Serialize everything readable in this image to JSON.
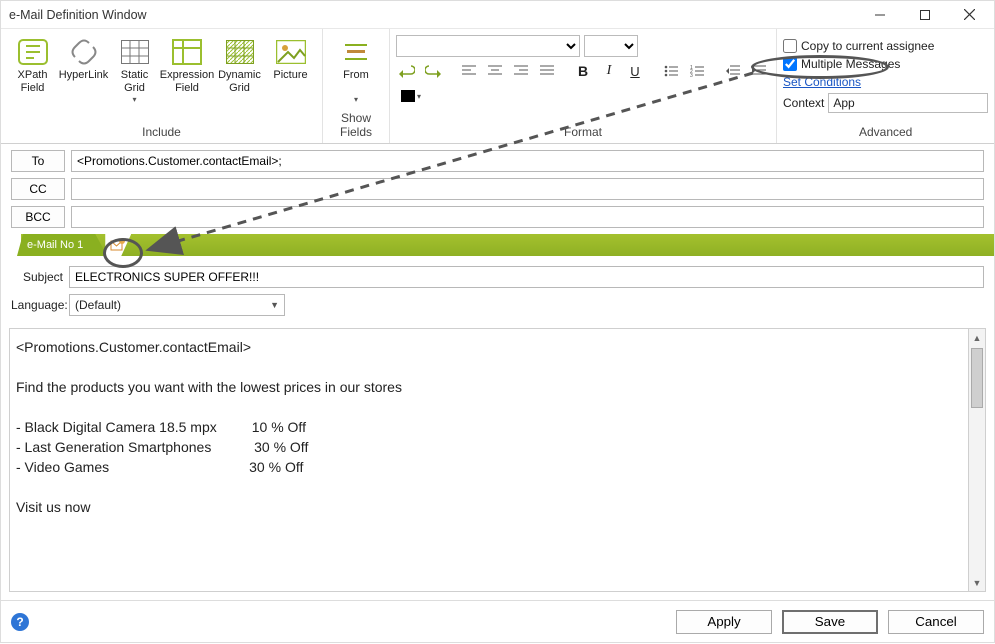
{
  "window": {
    "title": "e-Mail Definition Window"
  },
  "ribbon": {
    "include": {
      "label": "Include",
      "items": [
        {
          "label": "XPath\nField"
        },
        {
          "label": "HyperLink"
        },
        {
          "label": "Static\nGrid"
        },
        {
          "label": "Expression\nField"
        },
        {
          "label": "Dynamic\nGrid"
        },
        {
          "label": "Picture"
        }
      ]
    },
    "showfields": {
      "label": "Show Fields",
      "from": "From"
    },
    "format": {
      "label": "Format"
    },
    "advanced": {
      "label": "Advanced",
      "copy_assignee": "Copy to current assignee",
      "multiple_messages": "Multiple Messages",
      "set_conditions": "Set Conditions",
      "context_label": "Context",
      "context_value": "App"
    }
  },
  "fields": {
    "to_btn": "To",
    "cc_btn": "CC",
    "bcc_btn": "BCC",
    "to_value": "<Promotions.Customer.contactEmail>;",
    "cc_value": "",
    "bcc_value": ""
  },
  "tabs": {
    "email_tab": "e-Mail No 1"
  },
  "detail": {
    "subject_label": "Subject",
    "subject_value": "ELECTRONICS SUPER OFFER!!!",
    "language_label": "Language:",
    "language_value": "(Default)"
  },
  "body": "<Promotions.Customer.contactEmail>\n\nFind the products you want with the lowest prices in our stores\n\n- Black Digital Camera 18.5 mpx         10 % Off\n- Last Generation Smartphones           30 % Off\n- Video Games                                    30 % Off\n\nVisit us now",
  "footer": {
    "apply": "Apply",
    "save": "Save",
    "cancel": "Cancel"
  }
}
